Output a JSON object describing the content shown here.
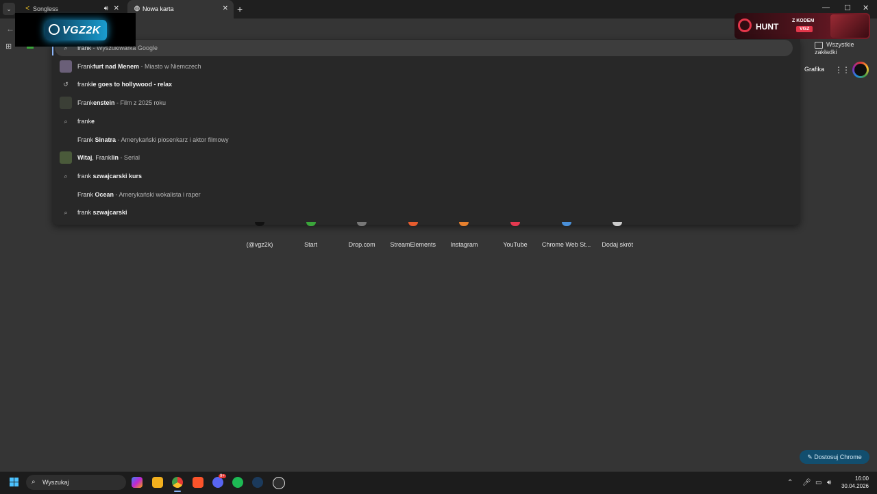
{
  "browser": {
    "tabs": [
      {
        "title": "Songless",
        "favicon": "songless-icon",
        "audio": true
      },
      {
        "title": "Nowa karta",
        "favicon": "chrome-newtab-icon",
        "active": true
      }
    ],
    "bookmarks_bar": {
      "all_bookmarks": "Wszystkie zakładki"
    }
  },
  "overlay": {
    "streamer_logo": "VGZ2K"
  },
  "ad": {
    "brand": "HUNT",
    "promo": "Z KODEM",
    "code": "VGZ"
  },
  "omnibox": {
    "query": "frank",
    "suggestions": [
      {
        "icon": "search-icon",
        "parts": [
          {
            "t": "frank",
            "b": false
          },
          {
            "t": " - Wyszukiwarka Google",
            "sub": true
          }
        ]
      },
      {
        "icon": "thumb",
        "thumb": "#6a5f78",
        "parts": [
          {
            "t": "Frank",
            "b": false
          },
          {
            "t": "furt nad Menem",
            "b": true
          },
          {
            "t": " - Miasto w Niemczech",
            "sub": true
          }
        ]
      },
      {
        "icon": "history-icon",
        "parts": [
          {
            "t": "frank",
            "b": false
          },
          {
            "t": "ie goes to hollywood - relax",
            "b": true
          }
        ]
      },
      {
        "icon": "thumb",
        "thumb": "#3b3f36",
        "parts": [
          {
            "t": "Frank",
            "b": false
          },
          {
            "t": "enstein",
            "b": true
          },
          {
            "t": " - Film z 2025 roku",
            "sub": true
          }
        ]
      },
      {
        "icon": "search-icon",
        "parts": [
          {
            "t": "frank",
            "b": false
          },
          {
            "t": "e",
            "b": true
          }
        ]
      },
      {
        "icon": "none",
        "parts": [
          {
            "t": "Frank ",
            "b": false
          },
          {
            "t": "Sinatra",
            "b": true
          },
          {
            "t": " - Amerykański piosenkarz i aktor filmowy",
            "sub": true
          }
        ]
      },
      {
        "icon": "thumb",
        "thumb": "#4a5a3a",
        "parts": [
          {
            "t": "Witaj",
            "b": true
          },
          {
            "t": ", Frank",
            "b": false
          },
          {
            "t": "lin",
            "b": true
          },
          {
            "t": " - Serial",
            "sub": true
          }
        ]
      },
      {
        "icon": "search-icon",
        "parts": [
          {
            "t": "frank ",
            "b": false
          },
          {
            "t": "szwajcarski kurs",
            "b": true
          }
        ]
      },
      {
        "icon": "none",
        "parts": [
          {
            "t": "Frank ",
            "b": false
          },
          {
            "t": "Ocean",
            "b": true
          },
          {
            "t": " - Amerykański wokalista i raper",
            "sub": true
          }
        ]
      },
      {
        "icon": "search-icon",
        "parts": [
          {
            "t": "frank ",
            "b": false
          },
          {
            "t": "szwajcarski",
            "b": true
          }
        ]
      }
    ]
  },
  "ntp": {
    "header_link": "Grafika",
    "shortcuts": [
      {
        "label": "(@vgz2k)",
        "color": "#111111"
      },
      {
        "label": "Start",
        "color": "#3aa53a"
      },
      {
        "label": "Drop.com",
        "color": "#777777"
      },
      {
        "label": "StreamElements",
        "color": "#e65c2e"
      },
      {
        "label": "Instagram",
        "color": "#e6802e"
      },
      {
        "label": "YouTube",
        "color": "#e53950"
      },
      {
        "label": "Chrome Web St...",
        "color": "#4a90d9"
      },
      {
        "label": "Dodaj skrót",
        "color": "#cccccc"
      }
    ],
    "customize": "Dostosuj Chrome"
  },
  "taskbar": {
    "search": "Wyszukaj",
    "apps": [
      "copilot-icon",
      "file-explorer-icon",
      "chrome-icon",
      "brave-icon",
      "discord-icon",
      "spotify-icon",
      "steam-icon",
      "game-icon"
    ],
    "discord_badge": "9+",
    "time": "16:00",
    "date": "30.04.2026"
  }
}
